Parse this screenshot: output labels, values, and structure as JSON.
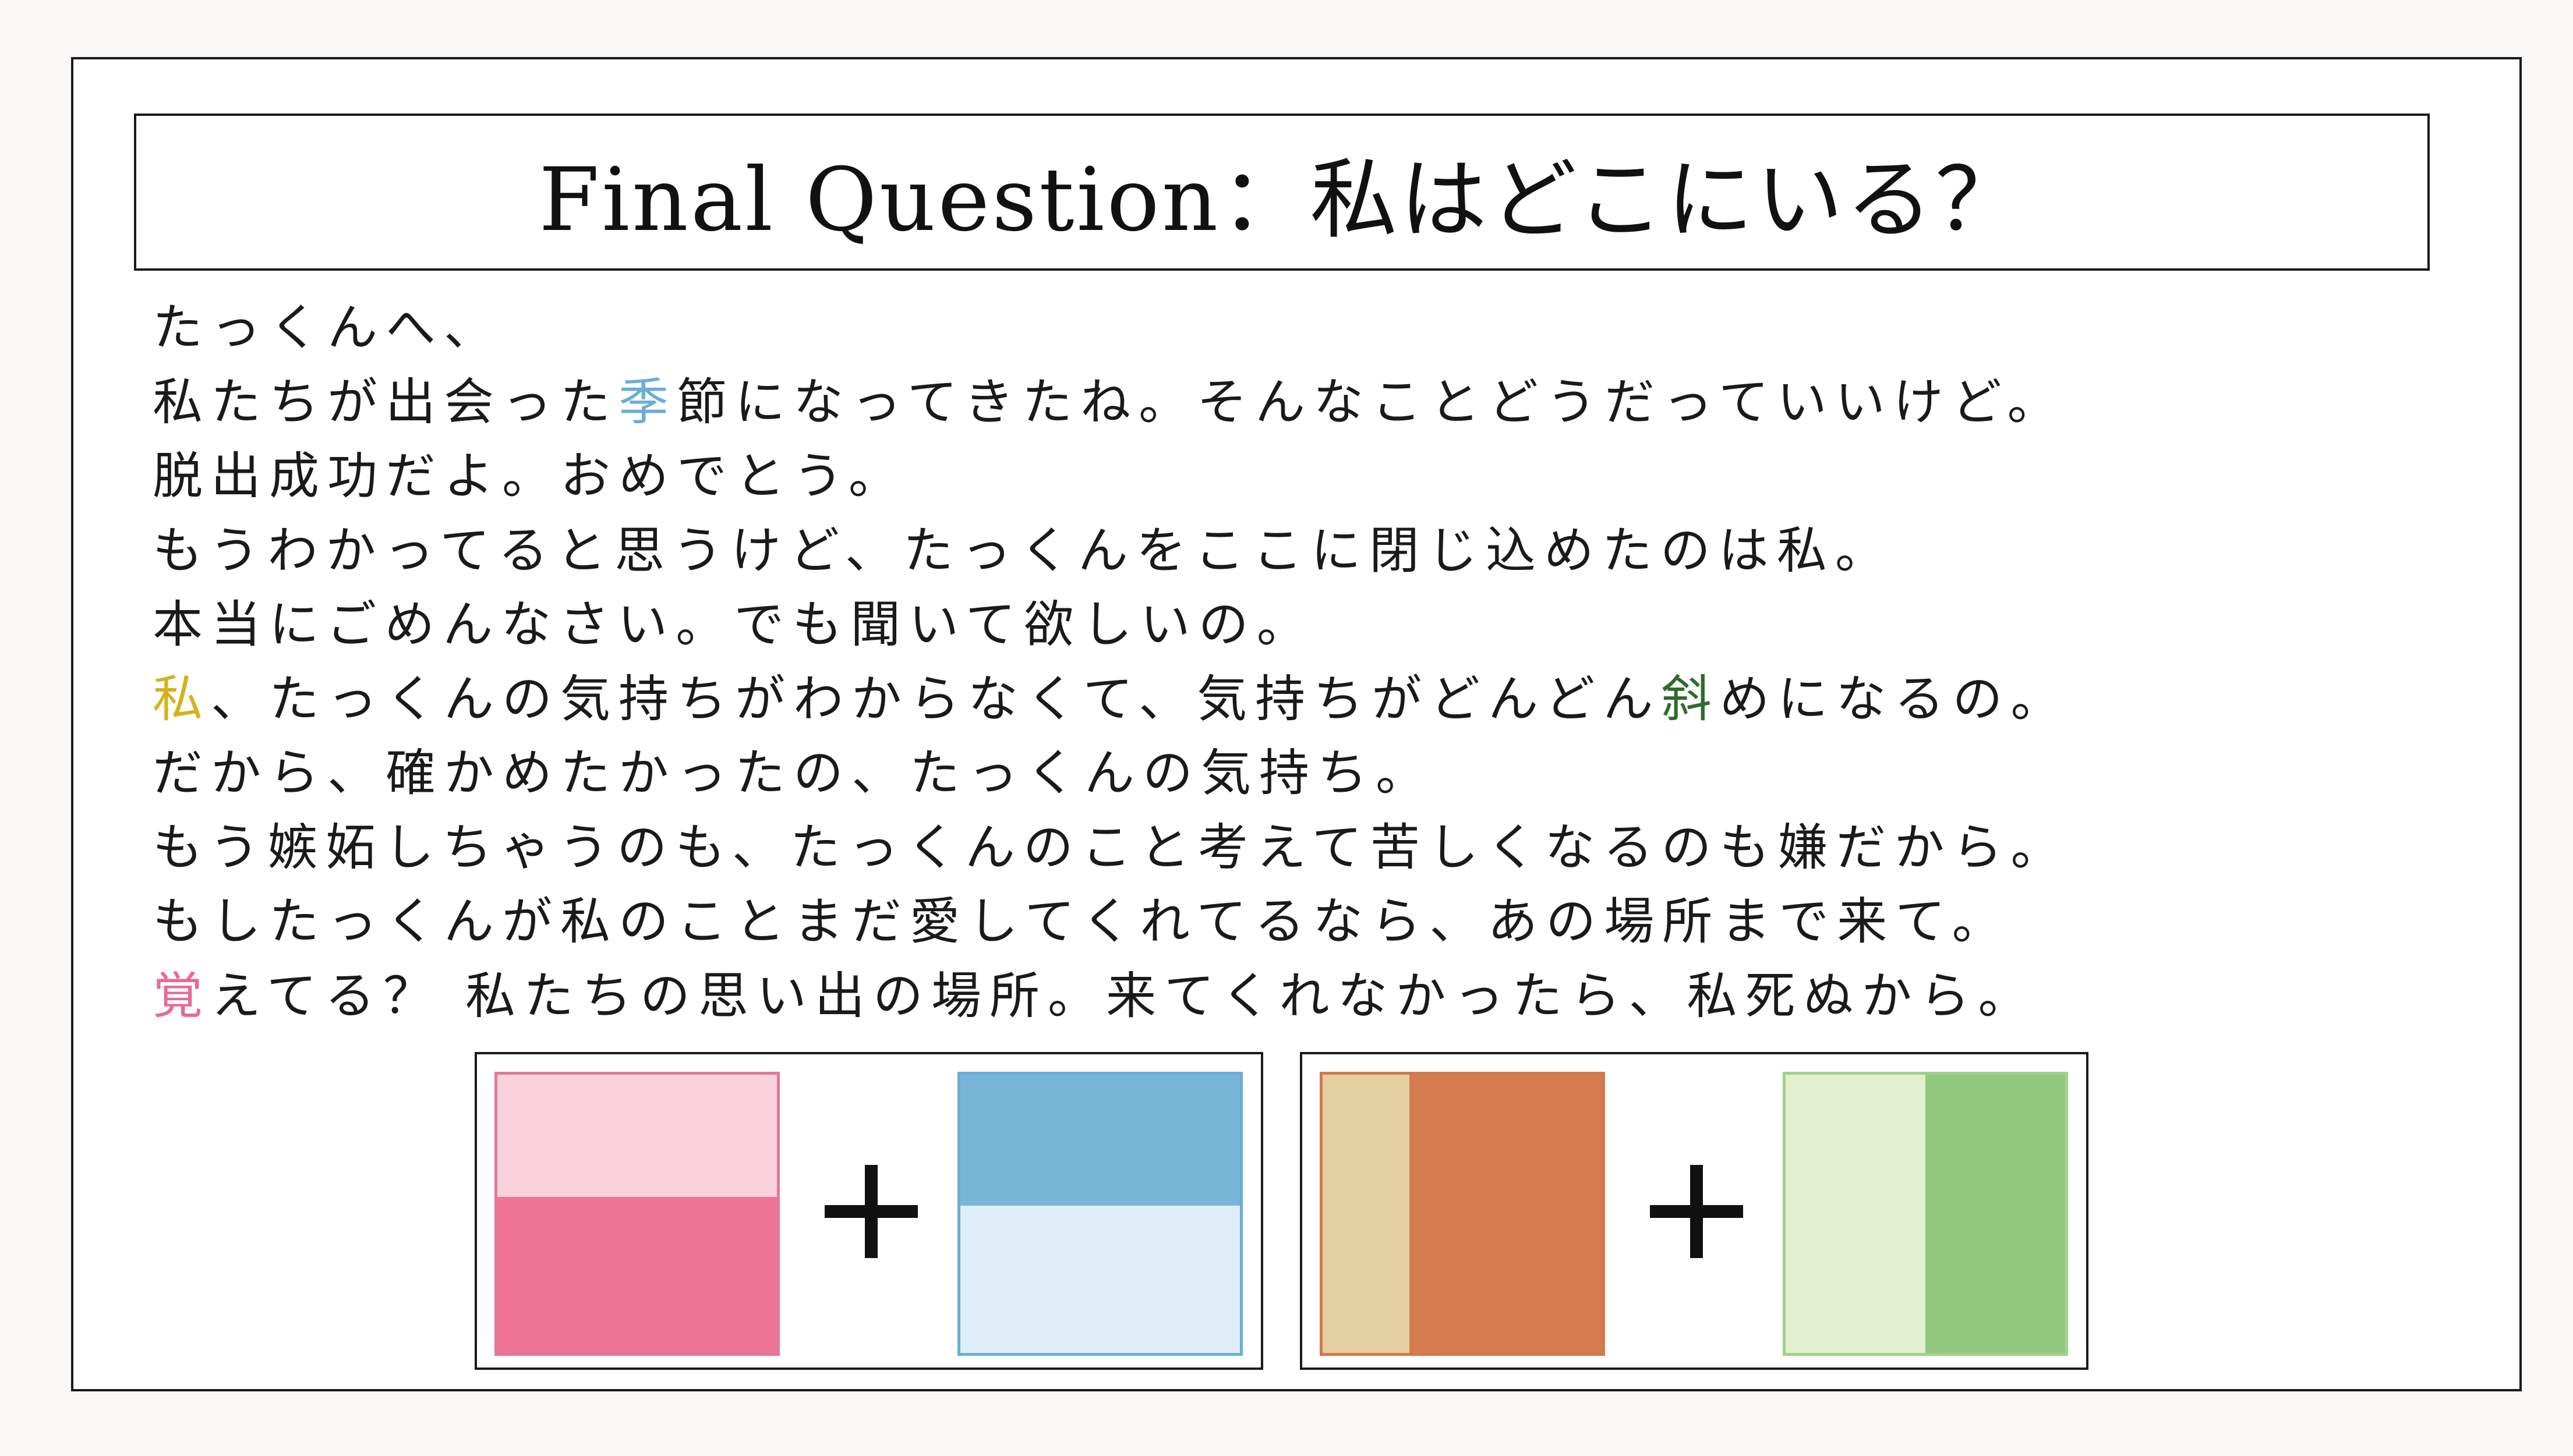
{
  "title": "Final Question：私はどこにいる？",
  "letter": {
    "lines": [
      [
        {
          "t": "たっくんへ、"
        }
      ],
      [
        {
          "t": "私たちが出会った"
        },
        {
          "t": "季",
          "c": "blue"
        },
        {
          "t": "節になってきたね。そんなことどうだっていいけど。"
        }
      ],
      [
        {
          "t": "脱出成功だよ。おめでとう。"
        }
      ],
      [
        {
          "t": "もうわかってると思うけど、たっくんをここに閉じ込めたのは私。"
        }
      ],
      [
        {
          "t": "本当にごめんなさい。でも聞いて欲しいの。"
        }
      ],
      [
        {
          "t": "私",
          "c": "yellow"
        },
        {
          "t": "、たっくんの気持ちがわからなくて、気持ちがどんどん"
        },
        {
          "t": "斜",
          "c": "green"
        },
        {
          "t": "めになるの。"
        }
      ],
      [
        {
          "t": "だから、確かめたかったの、たっくんの気持ち。"
        }
      ],
      [
        {
          "t": "もう嫉妬しちゃうのも、たっくんのこと考えて苦しくなるのも嫌だから。"
        }
      ],
      [
        {
          "t": "もしたっくんが私のことまだ愛してくれてるなら、あの場所まで来て。"
        }
      ],
      [
        {
          "t": "覚",
          "c": "pink"
        },
        {
          "t": "えてる？ 私たちの思い出の場所。来てくれなかったら、私死ぬから。"
        }
      ]
    ]
  },
  "puzzles": [
    {
      "name": "pink-plus-blue",
      "left_square": {
        "border": "#e07a95",
        "split": "horizontal",
        "fraction": 0.44,
        "first": "#f8d1da",
        "second": "#ef7394"
      },
      "right_square": {
        "border": "#6aaed6",
        "split": "horizontal",
        "fraction": 0.47,
        "first": "#78b6d7",
        "second": "#deedf7"
      },
      "operator_icon": "plus-icon"
    },
    {
      "name": "orange-plus-green",
      "left_square": {
        "border": "#d07a4a",
        "split": "vertical",
        "fraction": 0.31,
        "first": "#e4cfa0",
        "second": "#d37a4f"
      },
      "right_square": {
        "border": "#9fd28a",
        "split": "vertical",
        "fraction": 0.5,
        "first": "#e2f0cf",
        "second": "#93c97f"
      },
      "operator_icon": "plus-icon"
    }
  ]
}
